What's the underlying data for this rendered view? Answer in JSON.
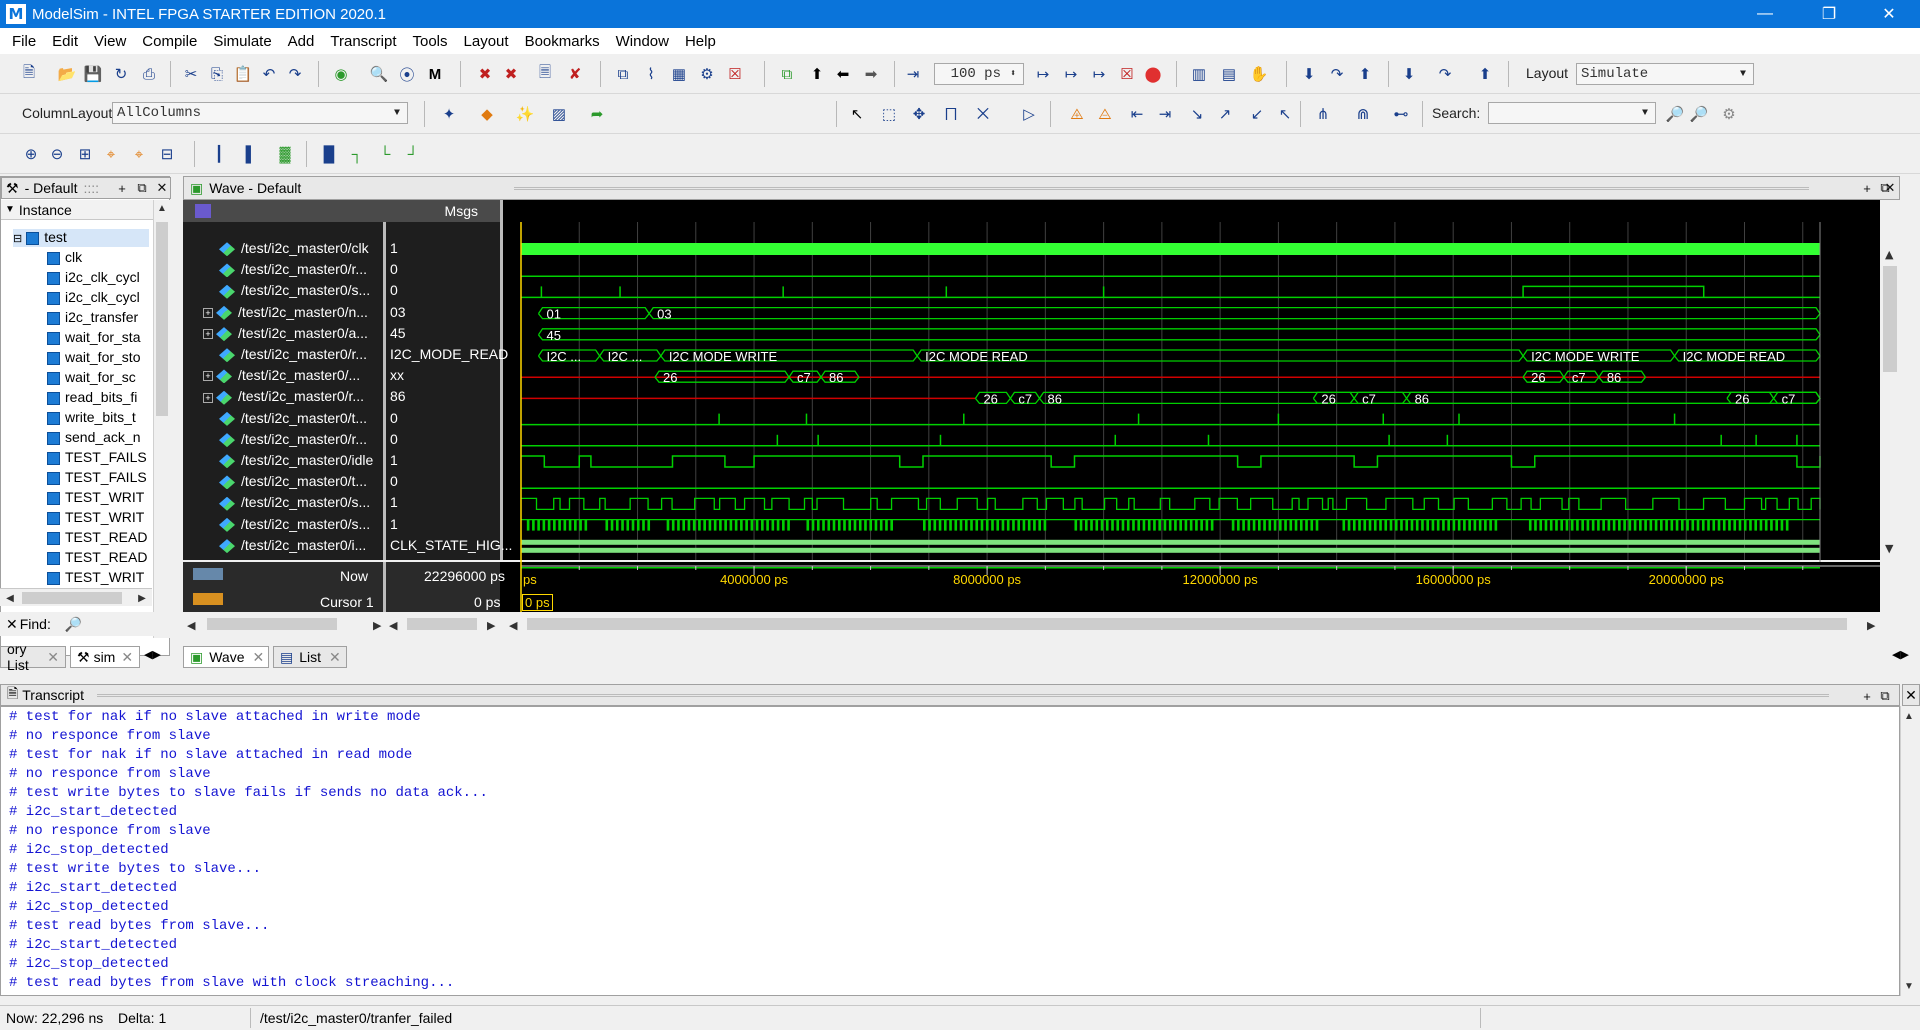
{
  "window": {
    "title": "ModelSim - INTEL FPGA STARTER EDITION 2020.1",
    "logo": "M"
  },
  "menu": [
    "File",
    "Edit",
    "View",
    "Compile",
    "Simulate",
    "Add",
    "Transcript",
    "Tools",
    "Layout",
    "Bookmarks",
    "Window",
    "Help"
  ],
  "toolbar": {
    "time_step": "100 ps",
    "layout_label": "Layout",
    "layout_value": "Simulate",
    "column_layout_label": "ColumnLayout",
    "column_layout_value": "AllColumns",
    "search_label": "Search:"
  },
  "instance_pane": {
    "title": "- Default",
    "column": "Instance",
    "root": "test",
    "items": [
      "clk",
      "i2c_clk_cycl",
      "i2c_clk_cycl",
      "i2c_transfer",
      "wait_for_sta",
      "wait_for_sto",
      "wait_for_sc",
      "read_bits_fi",
      "write_bits_t",
      "send_ack_n",
      "TEST_FAILS",
      "TEST_FAILS",
      "TEST_WRIT",
      "TEST_WRIT",
      "TEST_READ",
      "TEST_READ",
      "TEST_WRIT"
    ],
    "find_label": "Find:"
  },
  "wave": {
    "title": "Wave - Default",
    "msgs_header": "Msgs",
    "signals": [
      {
        "name": "/test/i2c_master0/clk",
        "value": "1",
        "expand": false
      },
      {
        "name": "/test/i2c_master0/r...",
        "value": "0",
        "expand": false
      },
      {
        "name": "/test/i2c_master0/s...",
        "value": "0",
        "expand": false
      },
      {
        "name": "/test/i2c_master0/n...",
        "value": "03",
        "expand": true
      },
      {
        "name": "/test/i2c_master0/a...",
        "value": "45",
        "expand": true
      },
      {
        "name": "/test/i2c_master0/r...",
        "value": "I2C_MODE_READ",
        "expand": false
      },
      {
        "name": "/test/i2c_master0/...",
        "value": "xx",
        "expand": true
      },
      {
        "name": "/test/i2c_master0/r...",
        "value": "86",
        "expand": true
      },
      {
        "name": "/test/i2c_master0/t...",
        "value": "0",
        "expand": false
      },
      {
        "name": "/test/i2c_master0/r...",
        "value": "0",
        "expand": false
      },
      {
        "name": "/test/i2c_master0/idle",
        "value": "1",
        "expand": false
      },
      {
        "name": "/test/i2c_master0/t...",
        "value": "0",
        "expand": false
      },
      {
        "name": "/test/i2c_master0/s...",
        "value": "1",
        "expand": false
      },
      {
        "name": "/test/i2c_master0/s...",
        "value": "1",
        "expand": false
      },
      {
        "name": "/test/i2c_master0/i...",
        "value": "CLK_STATE_HIG...",
        "expand": false
      }
    ],
    "bus_labels": {
      "n": [
        "01",
        "03"
      ],
      "a": [
        "45"
      ],
      "mode": [
        "I2C ...",
        "I2C ...",
        "I2C MODE WRITE",
        "I2C MODE READ",
        "I2C MODE WRITE",
        "I2C MODE READ"
      ],
      "x": [
        "26",
        "c7",
        "86",
        "26",
        "c7",
        "86"
      ],
      "r": [
        "26",
        "c7",
        "86",
        "26",
        "c7",
        "86",
        "26",
        "c7"
      ]
    },
    "now_label": "Now",
    "now_value": "22296000 ps",
    "cursor_label": "Cursor 1",
    "cursor_value": "0 ps",
    "cursor_marker": "0 ps",
    "axis_start": "ps",
    "axis_ticks": [
      "4000000 ps",
      "8000000 ps",
      "12000000 ps",
      "16000000 ps",
      "20000000 ps"
    ],
    "tabs": [
      "Wave",
      "List"
    ],
    "left_tabs": [
      "ory List",
      "sim"
    ]
  },
  "transcript": {
    "title": "Transcript",
    "lines": [
      "# test for nak if no slave attached in write mode",
      "# no responce from slave",
      "# test for nak if no slave attached in read mode",
      "# no responce from slave",
      "# test write bytes to slave fails if sends no data ack...",
      "# i2c_start_detected",
      "# no responce from slave",
      "# i2c_stop_detected",
      "# test write bytes to slave...",
      "# i2c_start_detected",
      "# i2c_stop_detected",
      "# test read bytes from slave...",
      "# i2c_start_detected",
      "# i2c_stop_detected",
      "# test read bytes from slave with clock streaching..."
    ]
  },
  "status": {
    "now": "Now: 22,296 ns",
    "delta": "Delta: 1",
    "path": "/test/i2c_master0/tranfer_failed"
  },
  "colors": {
    "wave_bg": "#000000",
    "signal": "#00d000",
    "clk": "#33ff33",
    "cursor": "#ffd800",
    "grid": "#404040",
    "transcript_text": "#1414d2"
  }
}
